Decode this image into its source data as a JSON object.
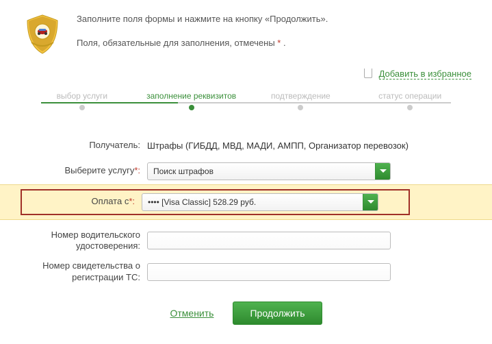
{
  "header": {
    "instruction": "Заполните поля формы и нажмите на кнопку «Продолжить».",
    "required_note_prefix": "Поля, обязательные для заполнения, отмечены ",
    "required_star": "*",
    "required_note_suffix": " ."
  },
  "favorites": {
    "label": "Добавить в избранное"
  },
  "steps": [
    {
      "label": "выбор услуги",
      "active": false
    },
    {
      "label": "заполнение реквизитов",
      "active": true
    },
    {
      "label": "подтверждение",
      "active": false
    },
    {
      "label": "статус операции",
      "active": false
    }
  ],
  "form": {
    "recipient_label": "Получатель:",
    "recipient_value": "Штрафы (ГИБДД, МВД, МАДИ, АМПП, Организатор перевозок)",
    "service_label": "Выберите услугу",
    "service_star": "*:",
    "service_value": "Поиск штрафов",
    "payfrom_label": "Оплата с",
    "payfrom_star": "*:",
    "payfrom_value": "••••           [Visa Classic] 528.29 руб.",
    "license_label": "Номер водительского удостоверения:",
    "reg_label": "Номер свидетельства о регистрации ТС:"
  },
  "actions": {
    "cancel": "Отменить",
    "continue": "Продолжить"
  },
  "colors": {
    "accent": "#3a8f3a",
    "highlight_bg": "#fff3c6",
    "highlight_border": "#a03028"
  }
}
